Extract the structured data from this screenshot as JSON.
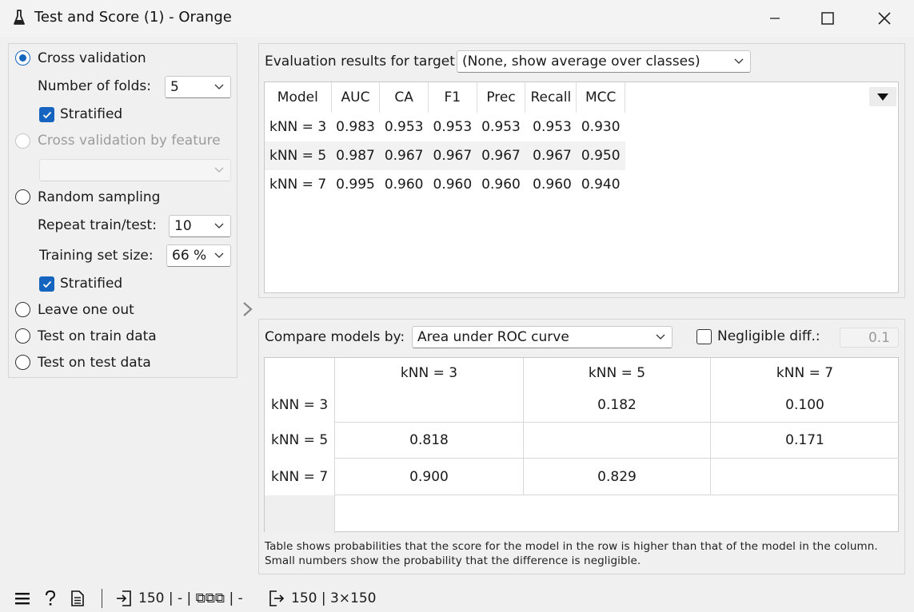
{
  "window": {
    "title": "Test and Score (1) - Orange",
    "icon": "orange-flask-icon"
  },
  "sampling": {
    "cross_validation": {
      "label": "Cross validation",
      "selected": true
    },
    "folds": {
      "label": "Number of folds:",
      "value": "5"
    },
    "stratified_cv": {
      "label": "Stratified",
      "checked": true
    },
    "cv_by_feature": {
      "label": "Cross validation by feature",
      "enabled": false,
      "value": ""
    },
    "random_sampling": {
      "label": "Random sampling",
      "selected": false
    },
    "repeat": {
      "label": "Repeat train/test:",
      "value": "10"
    },
    "train_size": {
      "label": "Training set size:",
      "value": "66 %"
    },
    "stratified_rs": {
      "label": "Stratified",
      "checked": true
    },
    "leave_one_out": {
      "label": "Leave one out"
    },
    "test_on_train": {
      "label": "Test on train data"
    },
    "test_on_test": {
      "label": "Test on test data"
    }
  },
  "evaluation": {
    "target_label": "Evaluation results for target",
    "target_value": "(None, show average over classes)",
    "columns": [
      "Model",
      "AUC",
      "CA",
      "F1",
      "Prec",
      "Recall",
      "MCC"
    ],
    "rows": [
      [
        "kNN = 3",
        "0.983",
        "0.953",
        "0.953",
        "0.953",
        "0.953",
        "0.930"
      ],
      [
        "kNN = 5",
        "0.987",
        "0.967",
        "0.967",
        "0.967",
        "0.967",
        "0.950"
      ],
      [
        "kNN = 7",
        "0.995",
        "0.960",
        "0.960",
        "0.960",
        "0.960",
        "0.940"
      ]
    ]
  },
  "comparison": {
    "compare_label": "Compare models by:",
    "compare_value": "Area under ROC curve",
    "negligible_label": "Negligible diff.:",
    "negligible_checked": false,
    "negligible_value": "0.1",
    "col_headers": [
      "kNN = 3",
      "kNN = 5",
      "kNN = 7"
    ],
    "row_headers": [
      "kNN = 3",
      "kNN = 5",
      "kNN = 7"
    ],
    "cells": [
      [
        "",
        "0.182",
        "0.100"
      ],
      [
        "0.818",
        "",
        "0.171"
      ],
      [
        "0.900",
        "0.829",
        ""
      ]
    ],
    "note_line1": "Table shows probabilities that the score for the model in the row is higher than that of the model in the column.",
    "note_line2": "Small numbers show the probability that the difference is negligible."
  },
  "statusbar": {
    "input_count": "150 | - | ⧉⧉⧉ | -",
    "output_count": "150 | 3×150"
  },
  "colors": {
    "accent": "#1565c0",
    "background": "#f0f0f0"
  }
}
